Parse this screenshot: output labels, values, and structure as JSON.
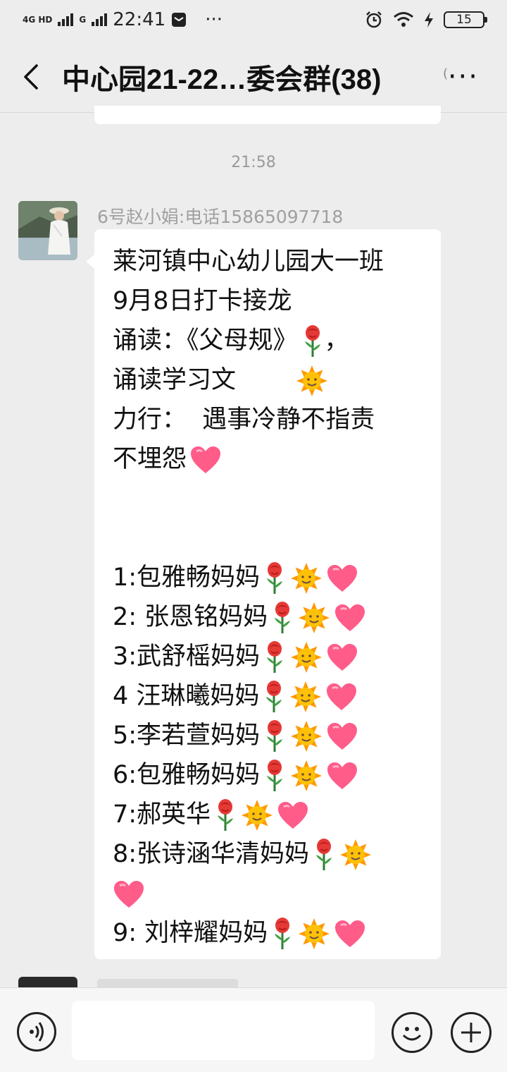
{
  "status_bar": {
    "network": "4G HD",
    "network2": "G",
    "time": "22:41",
    "more": "···",
    "battery": "15"
  },
  "chat": {
    "title": "中心园21-22…委会群(38)",
    "more_label": "···"
  },
  "messages": [
    {
      "timestamp": "21:58",
      "sender": "6号赵小娟:电话15865097718",
      "avatar": "avatar-photo",
      "text_lines": [
        "莱河镇中心幼儿园大一班",
        "9月8日打卡接龙",
        "诵读：《父母规》",
        "诵读学习文",
        "力行：  遇事冷静不指责",
        "不埋怨",
        "1:包雅畅妈妈",
        "2: 张恩铭妈妈",
        "3:武舒榣妈妈",
        "4 汪琳曦妈妈",
        "5:李若萱妈妈",
        "6:包雅畅妈妈",
        "7:郝英华",
        "8:张诗涵华清妈妈",
        "9: 刘梓耀妈妈"
      ],
      "line3_suffix": "，",
      "emoji_names": [
        "rose-icon",
        "sun-icon",
        "heart-icon"
      ]
    }
  ],
  "input": {
    "placeholder": ""
  },
  "colors": {
    "background": "#ededed",
    "bubble": "#ffffff",
    "timestamp": "#9a9a9a",
    "sender": "#a0a0a0"
  }
}
